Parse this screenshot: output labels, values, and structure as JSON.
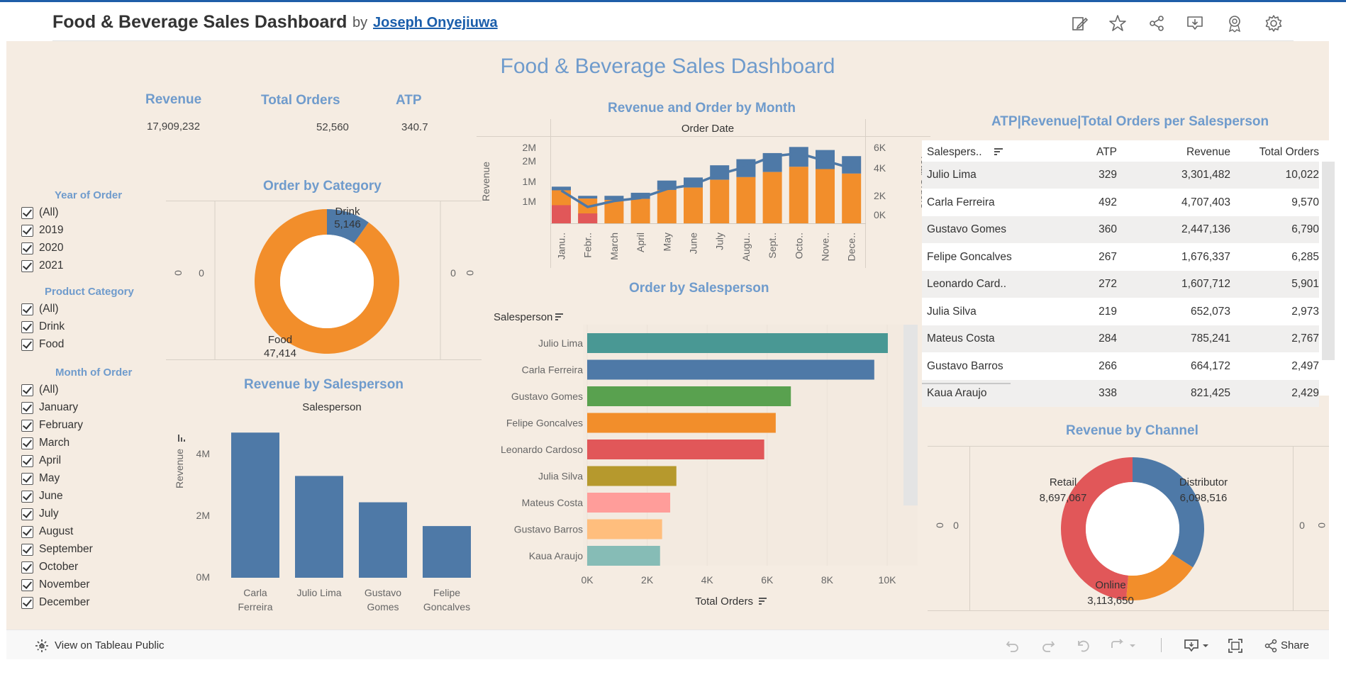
{
  "header": {
    "title": "Food & Beverage Sales Dashboard",
    "by": "by",
    "author": "Joseph Onyejiuwa"
  },
  "dashboard": {
    "title": "Food & Beverage Sales Dashboard",
    "kpis": [
      {
        "label": "Revenue",
        "value": "17,909,232"
      },
      {
        "label": "Total Orders",
        "value": "52,560"
      },
      {
        "label": "ATP",
        "value": "340.7"
      }
    ]
  },
  "filters": {
    "year": {
      "title": "Year of Order",
      "options": [
        "(All)",
        "2019",
        "2020",
        "2021"
      ]
    },
    "category": {
      "title": "Product Category",
      "options": [
        "(All)",
        "Drink",
        "Food"
      ]
    },
    "month": {
      "title": "Month of Order",
      "options": [
        "(All)",
        "January",
        "February",
        "March",
        "April",
        "May",
        "June",
        "July",
        "August",
        "September",
        "October",
        "November",
        "December"
      ]
    }
  },
  "order_by_category": {
    "title": "Order by Category",
    "zero_labels": [
      "0",
      "0",
      "0",
      "0"
    ]
  },
  "revenue_by_salesperson": {
    "title": "Revenue by Salesperson",
    "header": "Salesperson",
    "ylabel": "Revenue",
    "yticks": [
      "4M",
      "2M",
      "0M"
    ],
    "categories": [
      [
        "Carla",
        "Ferreira"
      ],
      [
        "Julio Lima"
      ],
      [
        "Gustavo",
        "Gomes"
      ],
      [
        "Felipe",
        "Goncalves"
      ]
    ]
  },
  "revenue_order_month": {
    "title": "Revenue and Order by Month",
    "header": "Order Date",
    "ylabel": "Revenue",
    "y2label": "Total Orders",
    "yticks": [
      "2M",
      "2M",
      "1M",
      "1M"
    ],
    "y2ticks": [
      "6K",
      "4K",
      "2K",
      "0K"
    ],
    "months": [
      "Janu..",
      "Febr..",
      "March",
      "April",
      "May",
      "June",
      "July",
      "Augu..",
      "Sept..",
      "Octo..",
      "Nove..",
      "Dece.."
    ]
  },
  "order_by_salesperson": {
    "title": "Order by Salesperson",
    "header": "Salesperson",
    "xlabel": "Total Orders",
    "xticks": [
      "0K",
      "2K",
      "4K",
      "6K",
      "8K",
      "10K"
    ]
  },
  "table": {
    "title": "ATP|Revenue|Total Orders per Salesperson",
    "columns": [
      "Salespers..",
      "ATP",
      "Revenue",
      "Total Orders"
    ],
    "rows": [
      [
        "Julio Lima",
        "329",
        "3,301,482",
        "10,022"
      ],
      [
        "Carla Ferreira",
        "492",
        "4,707,403",
        "9,570"
      ],
      [
        "Gustavo Gomes",
        "360",
        "2,447,136",
        "6,790"
      ],
      [
        "Felipe Goncalves",
        "267",
        "1,676,337",
        "6,285"
      ],
      [
        "Leonardo Card..",
        "272",
        "1,607,712",
        "5,901"
      ],
      [
        "Julia Silva",
        "219",
        "652,073",
        "2,973"
      ],
      [
        "Mateus Costa",
        "284",
        "785,241",
        "2,767"
      ],
      [
        "Gustavo Barros",
        "266",
        "664,172",
        "2,497"
      ],
      [
        "Kaua Araujo",
        "338",
        "821,425",
        "2,429"
      ]
    ]
  },
  "revenue_by_channel": {
    "title": "Revenue by Channel",
    "zero_labels": [
      "0",
      "0",
      "0",
      "0"
    ]
  },
  "footer": {
    "view_label": "View on Tableau Public",
    "share_label": "Share"
  },
  "chart_data": [
    {
      "type": "pie",
      "title": "Order by Category",
      "categories": [
        "Drink",
        "Food"
      ],
      "values": [
        5146,
        47414
      ],
      "value_labels": [
        "5,146",
        "47,414"
      ],
      "colors": [
        "#4e79a7",
        "#f28e2b"
      ]
    },
    {
      "type": "bar",
      "title": "Revenue by Salesperson",
      "categories": [
        "Carla Ferreira",
        "Julio Lima",
        "Gustavo Gomes",
        "Felipe Goncalves"
      ],
      "values": [
        4707403,
        3301482,
        2447136,
        1676337
      ],
      "ylabel": "Revenue",
      "ylim": [
        0,
        5000000
      ],
      "color": "#4e79a7"
    },
    {
      "type": "bar",
      "title": "Revenue and Order by Month",
      "categories": [
        "Janu..",
        "Febr..",
        "March",
        "April",
        "May",
        "June",
        "July",
        "Augu..",
        "Sept..",
        "Octo..",
        "Nove..",
        "Dece.."
      ],
      "series": [
        {
          "values": [
            1.2,
            0.9,
            0.9,
            1.0,
            1.4,
            1.5,
            1.9,
            2.1,
            2.3,
            2.5,
            2.4,
            2.2
          ]
        }
      ],
      "stack_fractions": [
        0.9,
        0.9,
        0.85,
        0.8,
        0.78,
        0.78,
        0.75,
        0.72,
        0.73,
        0.74,
        0.74,
        0.74
      ],
      "red_part": [
        0.55,
        0.4,
        0,
        0,
        0,
        0,
        0,
        0,
        0,
        0,
        0,
        0
      ],
      "line_values": [
        4200,
        3100,
        3500,
        3700,
        4300,
        4600,
        5300,
        5800,
        6500,
        6700,
        6200,
        5700
      ],
      "ylabel": "Revenue",
      "y2label": "Total Orders",
      "ylim": [
        0,
        2.6
      ],
      "y2lim": [
        0,
        7000
      ]
    },
    {
      "type": "bar",
      "title": "Order by Salesperson",
      "categories": [
        "Julio Lima",
        "Carla Ferreira",
        "Gustavo Gomes",
        "Felipe Goncalves",
        "Leonardo Cardoso",
        "Julia Silva",
        "Mateus Costa",
        "Gustavo Barros",
        "Kaua Araujo"
      ],
      "values": [
        10022,
        9570,
        6790,
        6285,
        5901,
        2973,
        2767,
        2497,
        2429
      ],
      "colors": [
        "#499894",
        "#4e79a7",
        "#59a14f",
        "#f28e2b",
        "#e15759",
        "#b6992d",
        "#ff9d9a",
        "#ffbe7d",
        "#86bcb6"
      ],
      "xlabel": "Total Orders",
      "xlim": [
        0,
        10500
      ]
    },
    {
      "type": "pie",
      "title": "Revenue by Channel",
      "categories": [
        "Distributor",
        "Online",
        "Retail"
      ],
      "values": [
        6098516,
        3113650,
        8697067
      ],
      "value_labels": [
        "6,098,516",
        "3,113,650",
        "8,697,067"
      ],
      "colors": [
        "#4e79a7",
        "#f28e2b",
        "#e15759"
      ]
    }
  ]
}
